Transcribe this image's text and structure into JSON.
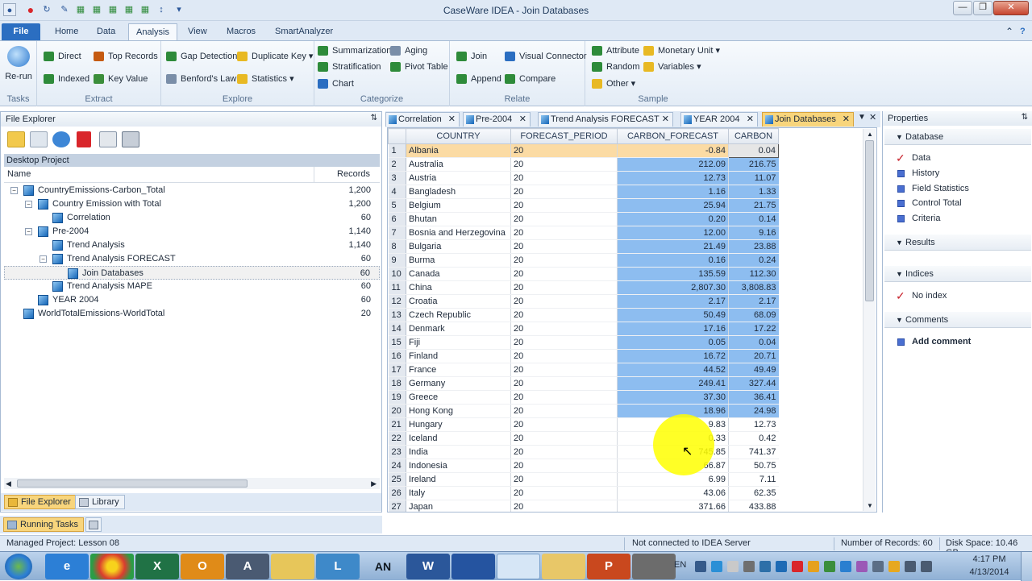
{
  "app": {
    "title": "CaseWare IDEA - Join Databases",
    "window_buttons": [
      "—",
      "❐",
      "✕"
    ]
  },
  "ribbon_tabs": [
    "File",
    "Home",
    "Data",
    "Analysis",
    "View",
    "Macros",
    "SmartAnalyzer"
  ],
  "ribbon": {
    "rerun_label": "Re-run",
    "groups": {
      "tasks": "Tasks",
      "extract": "Extract",
      "explore": "Explore",
      "categorize": "Categorize",
      "relate": "Relate",
      "sample": "Sample"
    },
    "extract": {
      "direct": "Direct",
      "top_records": "Top Records",
      "indexed": "Indexed",
      "key_value": "Key Value"
    },
    "explore": {
      "gap_detection": "Gap Detection",
      "duplicate_key": "Duplicate Key ▾",
      "benfords_law": "Benford's Law",
      "statistics": "Statistics ▾"
    },
    "categorize": {
      "summarization": "Summarization",
      "aging": "Aging",
      "stratification": "Stratification",
      "pivot_table": "Pivot Table",
      "chart": "Chart"
    },
    "relate": {
      "join": "Join",
      "visual_connector": "Visual Connector",
      "append": "Append",
      "compare": "Compare"
    },
    "sample": {
      "attribute": "Attribute",
      "monetary_unit": "Monetary Unit ▾",
      "random": "Random",
      "variables": "Variables ▾",
      "other": "Other ▾"
    }
  },
  "file_explorer": {
    "title": "File Explorer",
    "project": "Desktop Project",
    "col_name": "Name",
    "col_records": "Records",
    "tree": [
      {
        "name": "CountryEmissions-Carbon_Total",
        "records": "1,200"
      },
      {
        "name": "Country Emission with Total",
        "records": "1,200"
      },
      {
        "name": "Correlation",
        "records": "60"
      },
      {
        "name": "Pre-2004",
        "records": "1,140"
      },
      {
        "name": "Trend Analysis",
        "records": "1,140"
      },
      {
        "name": "Trend Analysis FORECAST",
        "records": "60"
      },
      {
        "name": "Join Databases",
        "records": "60"
      },
      {
        "name": "Trend Analysis MAPE",
        "records": "60"
      },
      {
        "name": "YEAR 2004",
        "records": "60"
      },
      {
        "name": "WorldTotalEmissions-WorldTotal",
        "records": "20"
      }
    ],
    "bottom_tabs": [
      "File Explorer",
      "Library"
    ],
    "running_tasks": "Running Tasks"
  },
  "doc_tabs": [
    "Correlation",
    "Pre-2004",
    "Trend Analysis FORECAST",
    "YEAR 2004",
    "Join Databases"
  ],
  "grid": {
    "columns": [
      "COUNTRY",
      "FORECAST_PERIOD",
      "CARBON_FORECAST",
      "CARBON"
    ],
    "rows": [
      [
        "1",
        "Albania",
        "20",
        "-0.84",
        "0.04"
      ],
      [
        "2",
        "Australia",
        "20",
        "212.09",
        "216.75"
      ],
      [
        "3",
        "Austria",
        "20",
        "12.73",
        "11.07"
      ],
      [
        "4",
        "Bangladesh",
        "20",
        "1.16",
        "1.33"
      ],
      [
        "5",
        "Belgium",
        "20",
        "25.94",
        "21.75"
      ],
      [
        "6",
        "Bhutan",
        "20",
        "0.20",
        "0.14"
      ],
      [
        "7",
        "Bosnia and Herzegovina",
        "20",
        "12.00",
        "9.16"
      ],
      [
        "8",
        "Bulgaria",
        "20",
        "21.49",
        "23.88"
      ],
      [
        "9",
        "Burma",
        "20",
        "0.16",
        "0.24"
      ],
      [
        "10",
        "Canada",
        "20",
        "135.59",
        "112.30"
      ],
      [
        "11",
        "China",
        "20",
        "2,807.30",
        "3,808.83"
      ],
      [
        "12",
        "Croatia",
        "20",
        "2.17",
        "2.17"
      ],
      [
        "13",
        "Czech Republic",
        "20",
        "50.49",
        "68.09"
      ],
      [
        "14",
        "Denmark",
        "20",
        "17.16",
        "17.22"
      ],
      [
        "15",
        "Fiji",
        "20",
        "0.05",
        "0.04"
      ],
      [
        "16",
        "Finland",
        "20",
        "16.72",
        "20.71"
      ],
      [
        "17",
        "France",
        "20",
        "44.52",
        "49.49"
      ],
      [
        "18",
        "Germany",
        "20",
        "249.41",
        "327.44"
      ],
      [
        "19",
        "Greece",
        "20",
        "37.30",
        "36.41"
      ],
      [
        "20",
        "Hong Kong",
        "20",
        "18.96",
        "24.98"
      ],
      [
        "21",
        "Hungary",
        "20",
        "9.83",
        "12.73"
      ],
      [
        "22",
        "Iceland",
        "20",
        "0.33",
        "0.42"
      ],
      [
        "23",
        "India",
        "20",
        "745.85",
        "741.37"
      ],
      [
        "24",
        "Indonesia",
        "20",
        "66.87",
        "50.75"
      ],
      [
        "25",
        "Ireland",
        "20",
        "6.99",
        "7.11"
      ],
      [
        "26",
        "Italy",
        "20",
        "43.06",
        "62.35"
      ],
      [
        "27",
        "Japan",
        "20",
        "371.66",
        "433.88"
      ]
    ],
    "selected_rows_through": 20
  },
  "properties": {
    "title": "Properties",
    "database_section": "Database",
    "database_items": [
      "Data",
      "History",
      "Field Statistics",
      "Control Total",
      "Criteria"
    ],
    "results_section": "Results",
    "indices_section": "Indices",
    "indices_item": "No index",
    "comments_section": "Comments",
    "comments_item": "Add comment"
  },
  "status": {
    "project": "Managed Project: Lesson 08",
    "server": "Not connected to IDEA Server",
    "records": "Number of Records: 60",
    "disk": "Disk Space: 10.46 GB"
  },
  "taskbar": {
    "apps": [
      "IE",
      "Chrome",
      "Excel",
      "Outlook",
      "AS",
      "Folder",
      "Lync",
      "AN",
      "Word",
      "Network",
      "IDEA",
      "Explorer",
      "PowerPoint",
      "Tool"
    ],
    "an_label": "AN",
    "lang": "EN",
    "time": "4:17 PM",
    "date": "4/13/2014"
  }
}
